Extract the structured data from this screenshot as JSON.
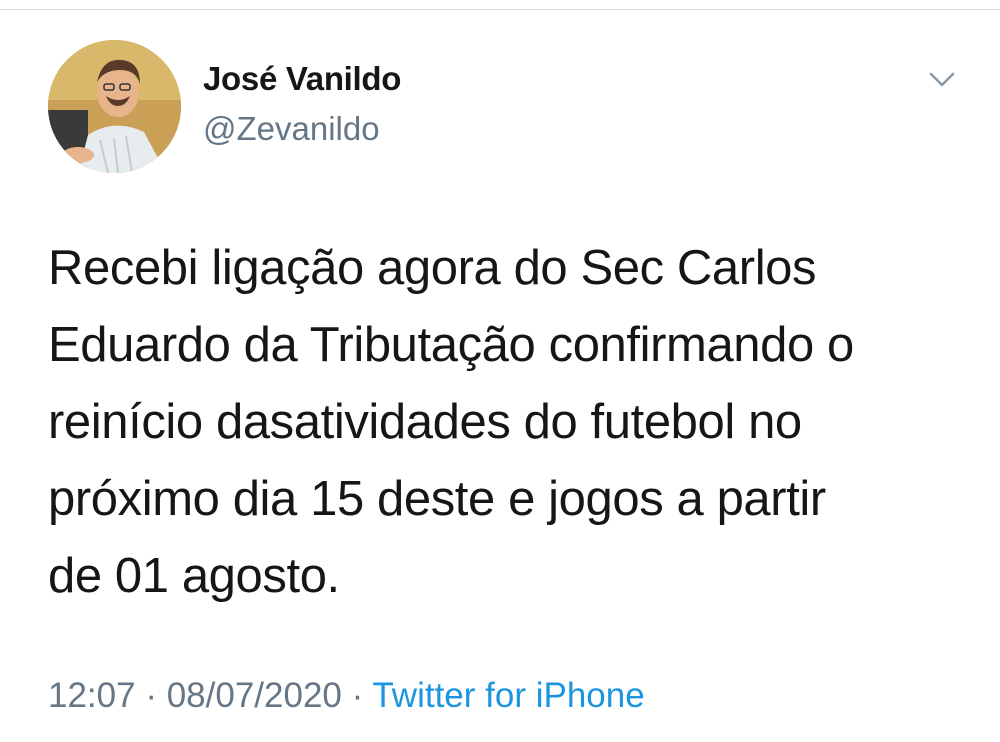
{
  "tweet": {
    "author": {
      "display_name": "José Vanildo",
      "handle": "@Zevanildo"
    },
    "text_lines": [
      "Recebi ligação agora do Sec Carlos",
      "Eduardo da Tributação confirmando o",
      "reinício dasatividades do futebol no",
      "próximo dia 15 deste e jogos a partir",
      "de 01 agosto."
    ],
    "meta": {
      "time": "12:07",
      "separator": " · ",
      "date": "08/07/2020",
      "source": "Twitter for iPhone"
    },
    "icons": {
      "menu": "chevron-down-icon"
    },
    "colors": {
      "text": "#14171a",
      "secondary": "#657786",
      "link": "#1b95e0"
    }
  }
}
